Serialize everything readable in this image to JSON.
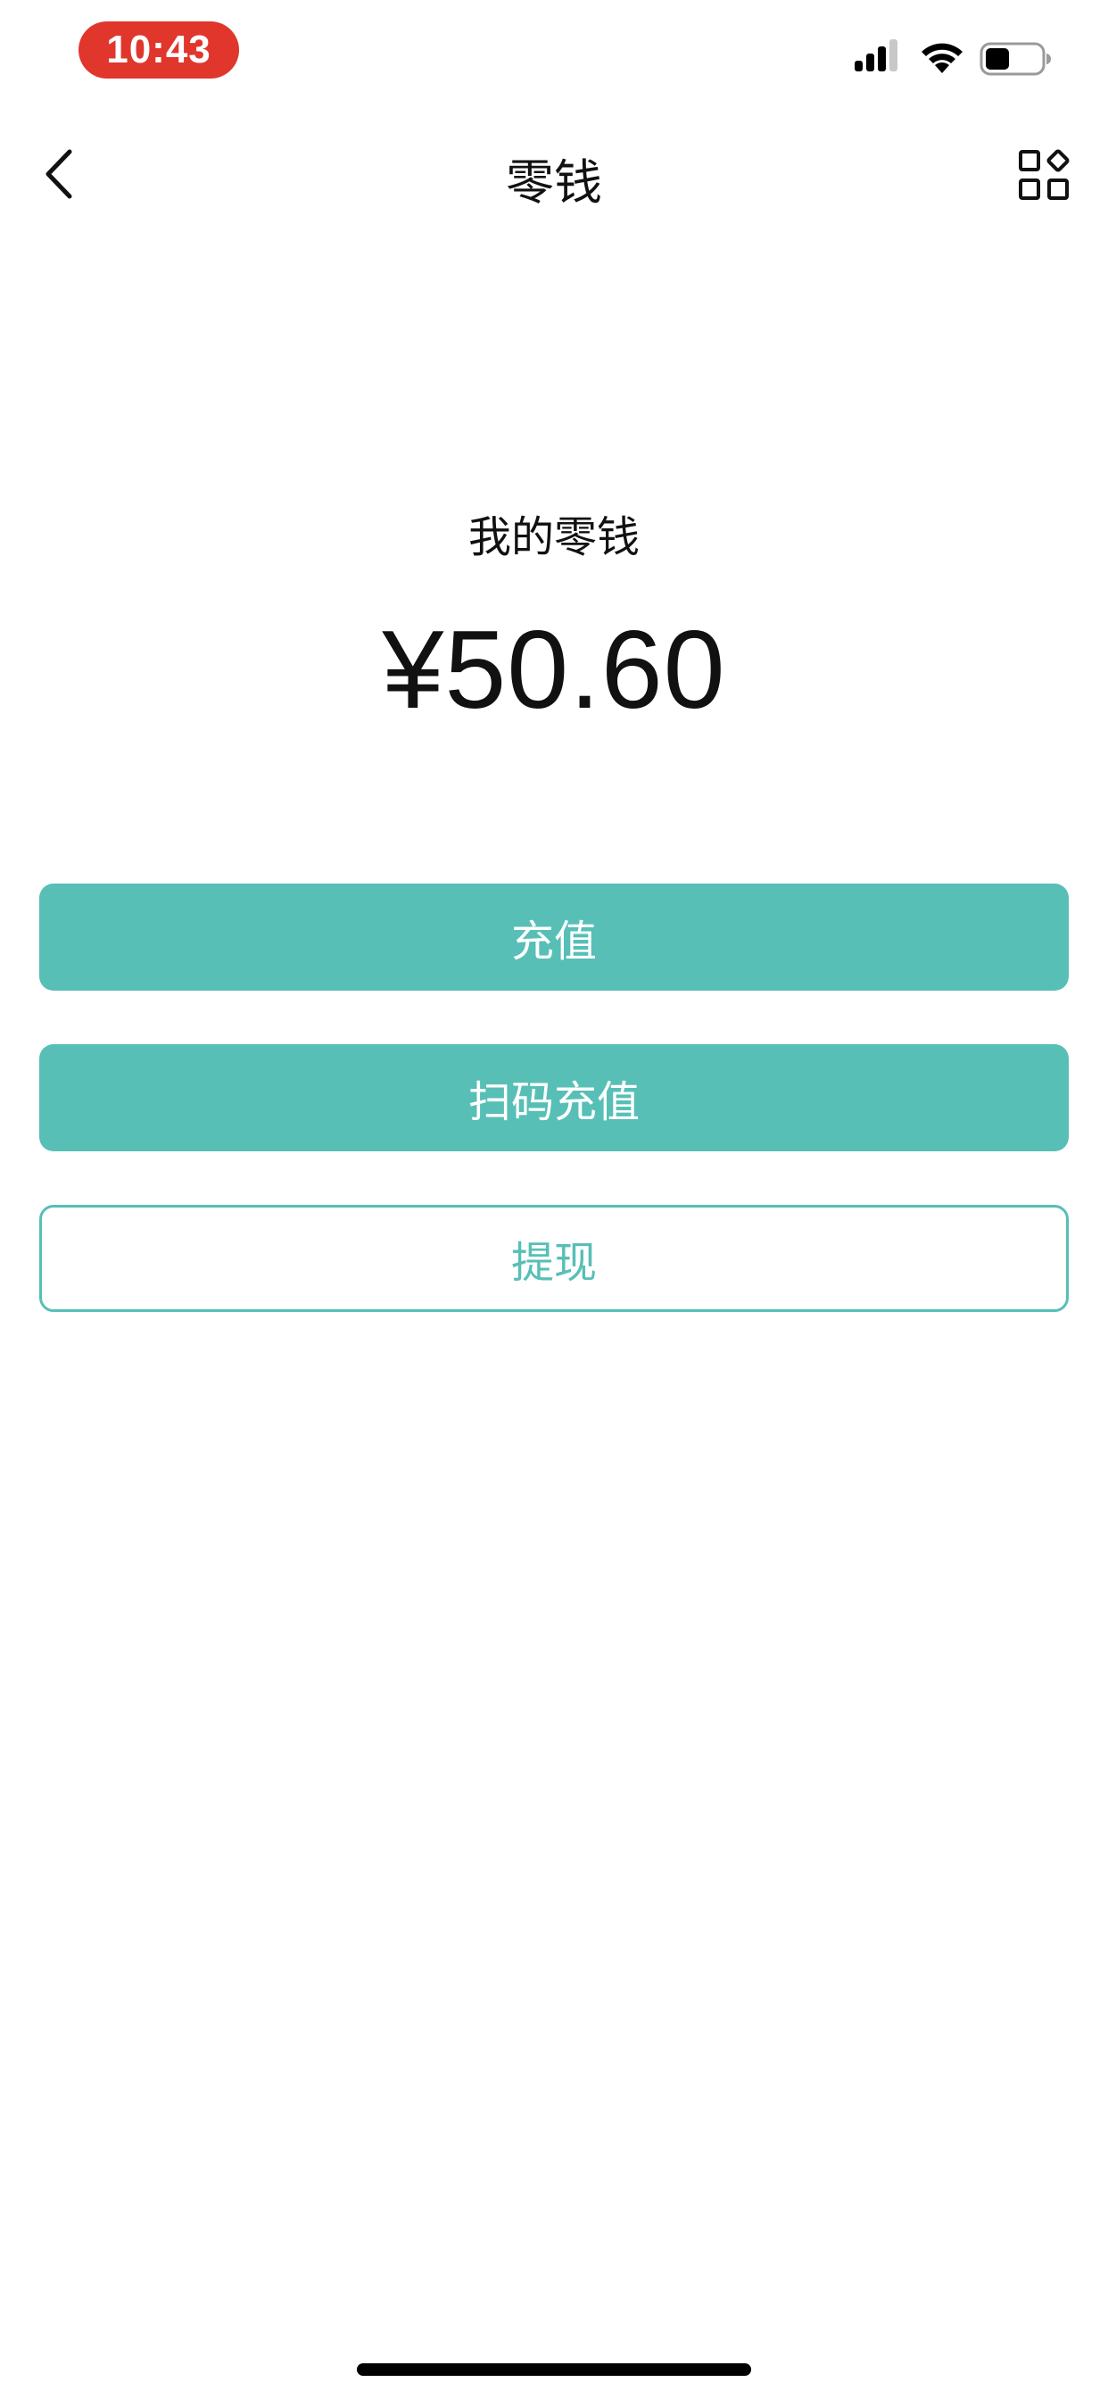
{
  "status_bar": {
    "time": "10:43",
    "time_pill_color": "#e0362c"
  },
  "nav": {
    "title": "零钱",
    "back_icon": "chevron-left-icon",
    "more_icon": "grid-apps-icon"
  },
  "balance": {
    "label": "我的零钱",
    "amount": "¥50.60"
  },
  "actions": {
    "recharge_label": "充值",
    "scan_recharge_label": "扫码充值",
    "withdraw_label": "提现"
  },
  "colors": {
    "accent": "#57bfb6",
    "text": "#111111",
    "background": "#ffffff"
  }
}
